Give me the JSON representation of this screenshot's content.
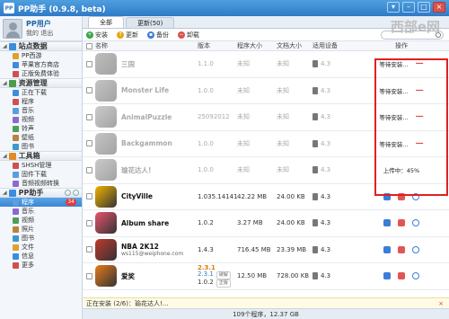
{
  "window": {
    "logo": "PP",
    "title": "PP助手 (0.9.8, beta)",
    "controls": [
      "▾",
      "–",
      "□",
      "×"
    ]
  },
  "watermark": "西部e网",
  "user": {
    "name": "PP用户",
    "sub": "我的 退出"
  },
  "sidebar": {
    "sections": [
      {
        "title": "站点数据",
        "items": [
          "PP西游",
          "苹果官方商店",
          "正版免费体验"
        ]
      },
      {
        "title": "资源管理",
        "items": [
          "正在下载",
          "程序",
          "音乐",
          "视频",
          "铃声",
          "壁纸",
          "图书"
        ]
      },
      {
        "title": "工具箱",
        "items": [
          "SHSH管理",
          "固件下载",
          "音频视频转换"
        ]
      },
      {
        "title": "PP助手",
        "items": [
          "程序",
          "音乐",
          "视频",
          "照片",
          "图书",
          "文件",
          "信息",
          "更多"
        ],
        "badge": "34"
      }
    ]
  },
  "tabs": [
    "全部",
    "更新(50)"
  ],
  "toolbar": {
    "buttons": [
      "安装",
      "更新",
      "备份",
      "卸载"
    ],
    "search_placeholder": ""
  },
  "columns": [
    "名称",
    "版本",
    "程序大小",
    "文档大小",
    "适用设备",
    "操作"
  ],
  "rows": [
    {
      "name": "三国",
      "sub": "",
      "version": "1.1.0",
      "psize": "未知",
      "dsize": "未知",
      "device": "4.3",
      "status": "等待安装...",
      "faded": true,
      "color": "#6b6b6b"
    },
    {
      "name": "Monster Life",
      "sub": "",
      "version": "1.0.0",
      "psize": "未知",
      "dsize": "未知",
      "device": "4.3",
      "status": "等待安装...",
      "faded": true,
      "color": "#7a7a7a"
    },
    {
      "name": "AnimalPuzzle",
      "sub": "",
      "version": "25092012",
      "psize": "未知",
      "dsize": "未知",
      "device": "4.3",
      "status": "等待安装...",
      "faded": true,
      "color": "#8a8a8a"
    },
    {
      "name": "Backgammon",
      "sub": "",
      "version": "1.0.0",
      "psize": "未知",
      "dsize": "未知",
      "device": "4.3",
      "status": "等待安装...",
      "faded": true,
      "color": "#7c7c7c"
    },
    {
      "name": "瑜花达人!",
      "sub": "",
      "version": "1.0.0",
      "psize": "未知",
      "dsize": "未知",
      "device": "4.3",
      "status": "上传中：45%",
      "faded": true,
      "color": "#888888"
    },
    {
      "name": "CityVille",
      "sub": "",
      "version": "1.035.14141",
      "psize": "42.22 MB",
      "dsize": "24.00 KB",
      "device": "4.3",
      "status": "",
      "faded": false,
      "color": "#f0b400"
    },
    {
      "name": "Album share",
      "sub": "",
      "version": "1.0.2",
      "psize": "3.27 MB",
      "dsize": "24.00 KB",
      "device": "4.3",
      "status": "",
      "faded": false,
      "color": "#e8546c"
    },
    {
      "name": "NBA 2K12",
      "sub": "ws115@weiphone.com",
      "version": "1.4.3",
      "psize": "716.45 MB",
      "dsize": "23.39 MB",
      "device": "4.3",
      "status": "",
      "faded": false,
      "color": "#c0392b"
    },
    {
      "name": "爱奖",
      "sub": "",
      "version": "2.3.1",
      "version2": "2.3.1",
      "version3": "1.0.2",
      "tag1": "破解",
      "tag2": "正版",
      "psize": "12.50 MB",
      "dsize": "728.00 KB",
      "device": "4.3",
      "status": "",
      "faded": false,
      "color": "#e87a1a"
    }
  ],
  "install_bar": {
    "text": "正在安装 (2/6)：瑜花达人!...",
    "clear": "×"
  },
  "statusbar": "109个程序，12.37 GB"
}
